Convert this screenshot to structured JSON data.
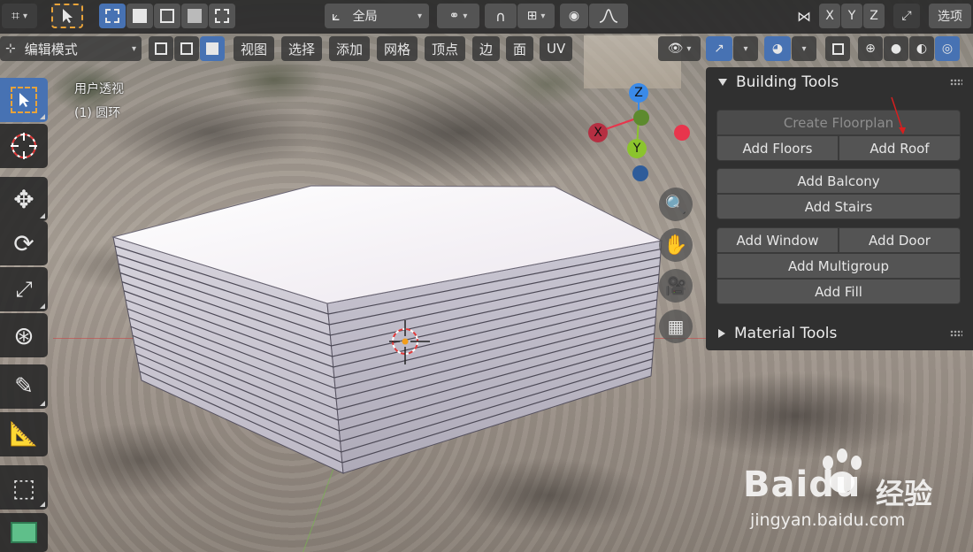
{
  "topbar": {
    "transform_orientation": "全局",
    "axes": [
      "X",
      "Y",
      "Z"
    ],
    "options_label": "选项"
  },
  "header": {
    "mode": "编辑模式",
    "menus": [
      "视图",
      "选择",
      "添加",
      "网格",
      "顶点",
      "边",
      "面",
      "UV"
    ]
  },
  "viewport": {
    "view_name": "用户透视",
    "object_info": "(1) 圆环",
    "gizmo": {
      "z": "Z",
      "x": "X",
      "y": "Y"
    },
    "colors": {
      "x_axis": "#e8354c",
      "y_axis": "#8bc42d",
      "z_axis": "#3a8ae8",
      "accent": "#4772b3"
    }
  },
  "panel": {
    "building_tools": {
      "title": "Building Tools",
      "create_floorplan": "Create Floorplan",
      "add_floors": "Add Floors",
      "add_roof": "Add Roof",
      "add_balcony": "Add Balcony",
      "add_stairs": "Add Stairs",
      "add_window": "Add Window",
      "add_door": "Add Door",
      "add_multigroup": "Add Multigroup",
      "add_fill": "Add Fill"
    },
    "material_tools": {
      "title": "Material Tools"
    }
  },
  "watermark": {
    "logo": "Baidu",
    "cn": "经验",
    "url": "jingyan.baidu.com"
  }
}
